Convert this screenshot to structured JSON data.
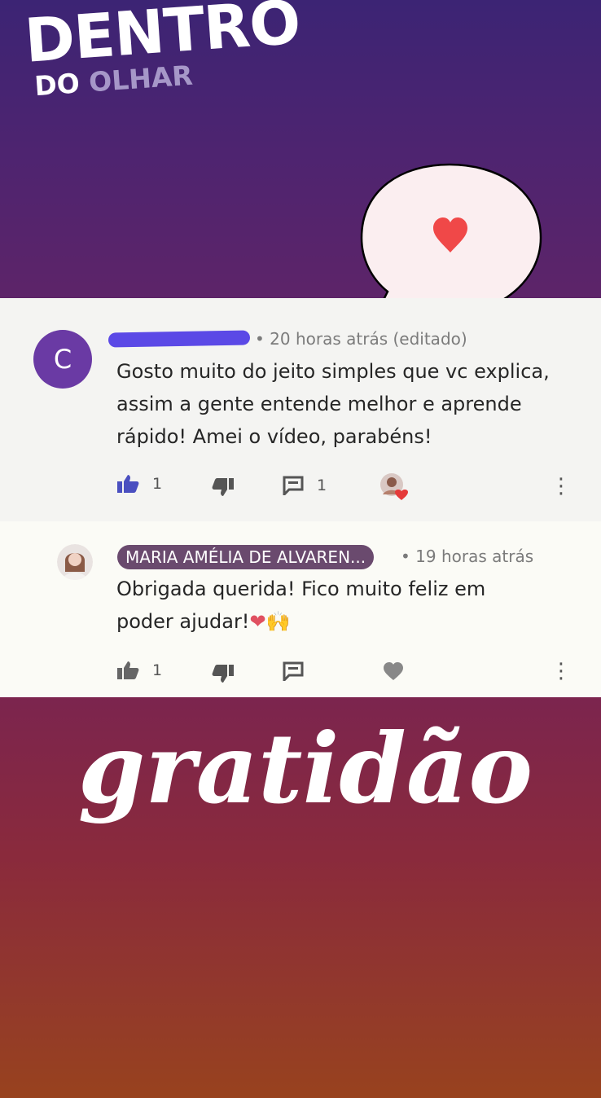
{
  "brand": {
    "main": "DENTRO",
    "sub1": "DO",
    "sub2": "OLHAR"
  },
  "comment": {
    "avatar_letter": "C",
    "timestamp": "• 20 horas atrás (editado)",
    "text": "Gosto muito do jeito simples que vc explica, assim a gente entende melhor e aprende rápido! Amei o vídeo, parabéns!",
    "likes": "1",
    "replies": "1"
  },
  "reply": {
    "author": "MARIA AMÉLIA DE ALVAREN...",
    "timestamp": "• 19 horas atrás",
    "text": "Obrigada querida! Fico muito feliz em poder ajudar!",
    "emojis": "❤🙌",
    "likes": "1"
  },
  "overlay_text": "gratidão",
  "colors": {
    "accent": "#6a3aa4",
    "like_active": "#4a4fc0",
    "heart": "#e53a3a"
  }
}
